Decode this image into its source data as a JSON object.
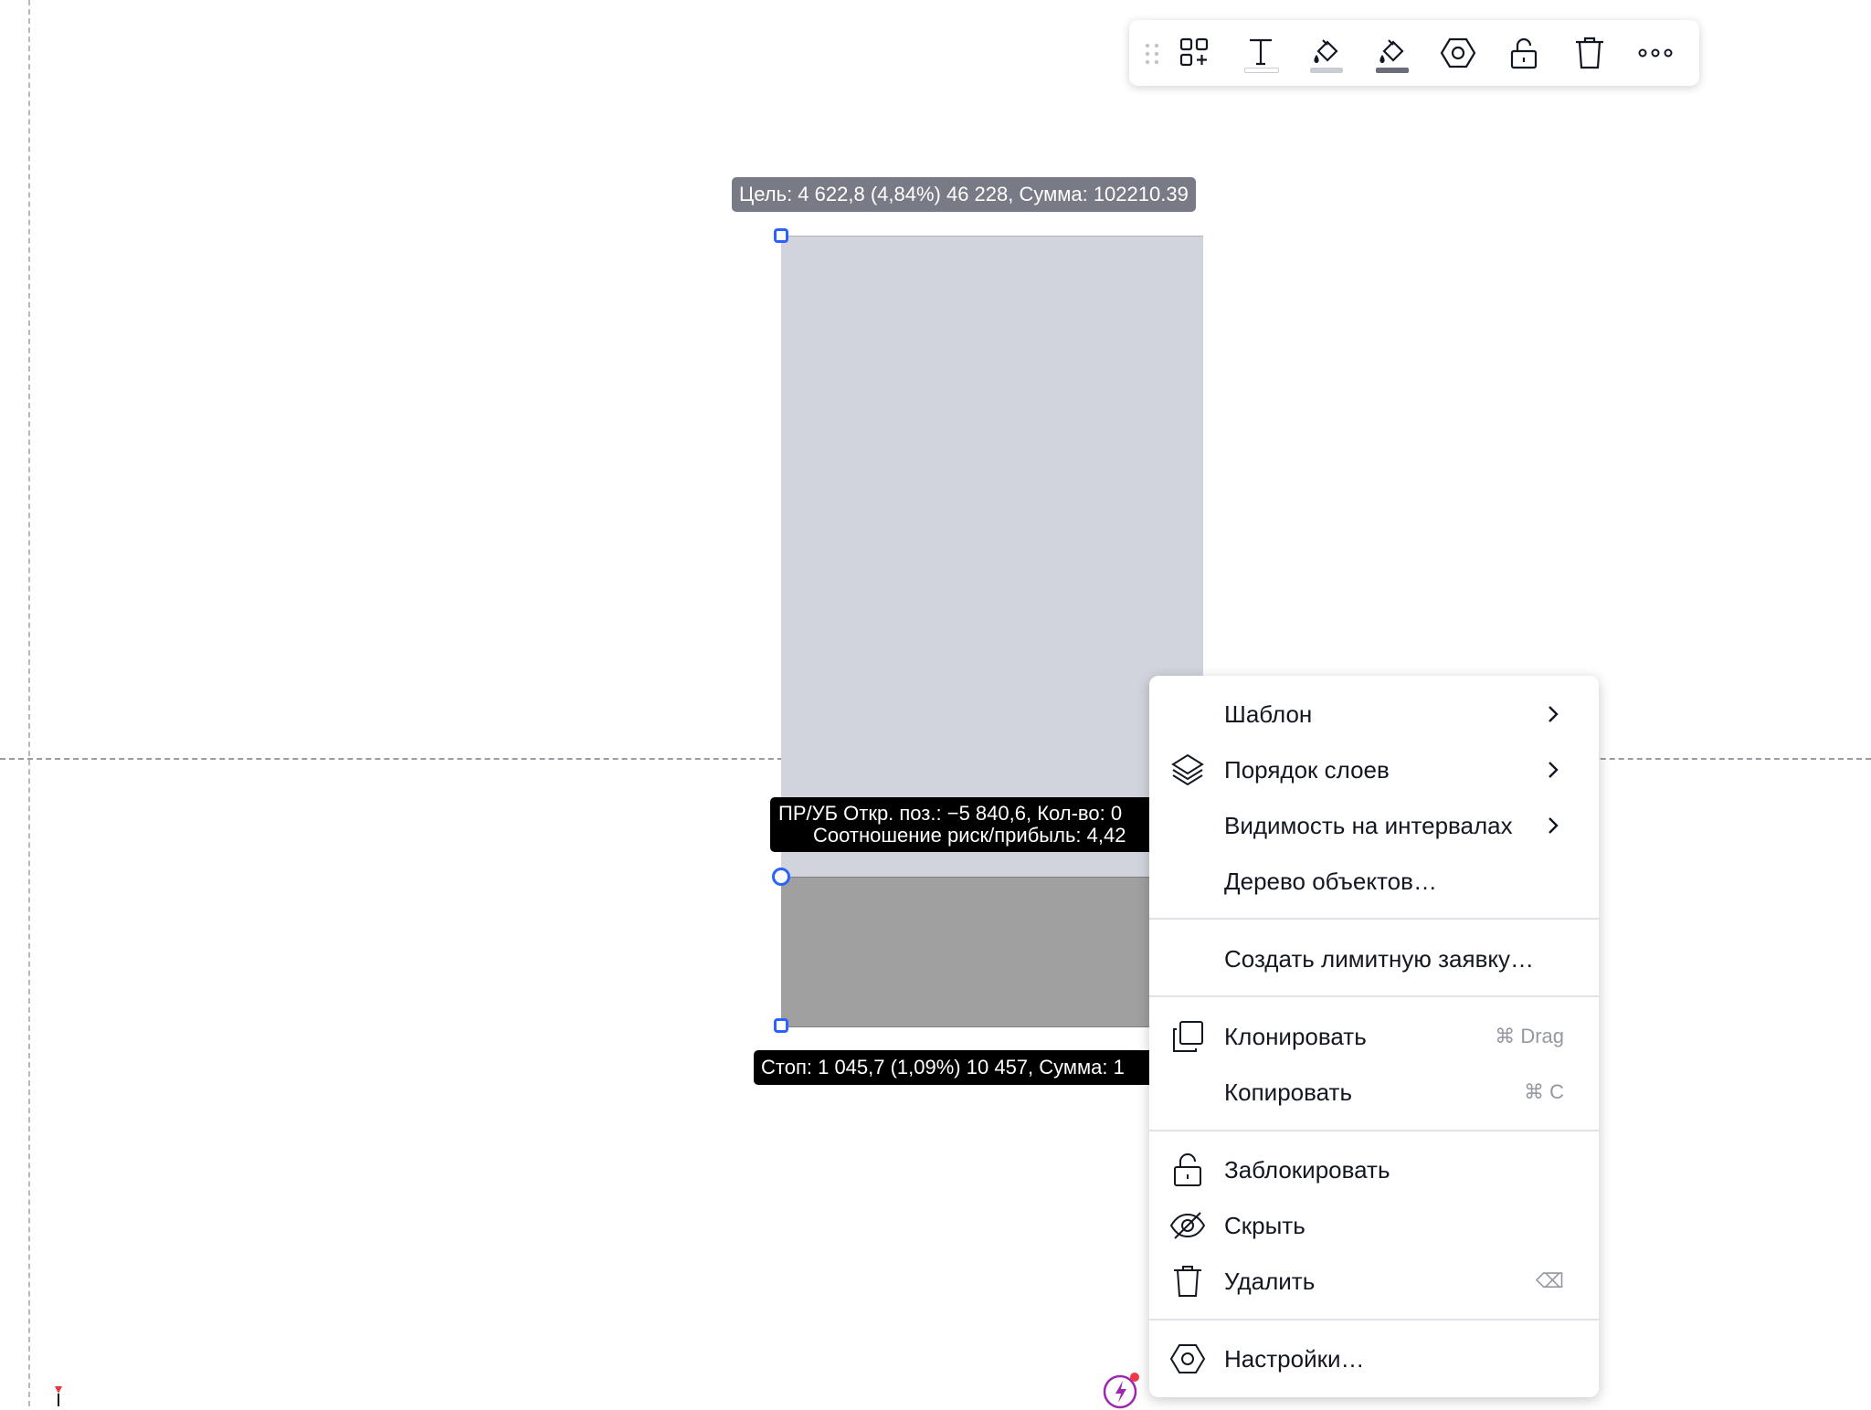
{
  "toolbar": {
    "buttons": [
      {
        "name": "drag-handle-icon"
      },
      {
        "name": "add-template-icon"
      },
      {
        "name": "text-icon"
      },
      {
        "name": "fill-bucket-light-icon"
      },
      {
        "name": "fill-bucket-dark-icon"
      },
      {
        "name": "settings-hexagon-icon"
      },
      {
        "name": "lock-open-icon"
      },
      {
        "name": "trash-icon"
      },
      {
        "name": "more-icon"
      }
    ]
  },
  "drawing": {
    "target_label": "Цель: 4 622,8 (4,84%) 46 228, Сумма: 102210.39",
    "pnl_line1": "ПР/УБ Откр. поз.: −5 840,6, Кол-во: 0",
    "pnl_line2": "Соотношение риск/прибыль: 4,42",
    "stop_label": "Стоп: 1 045,7 (1,09%) 10 457, Сумма: 1",
    "colors": {
      "target": "#d1d4dc",
      "stop": "#a0a0a0",
      "handle": "#2962ff"
    }
  },
  "context_menu": {
    "template": "Шаблон",
    "layer_order": "Порядок слоев",
    "visibility": "Видимость на интервалах",
    "object_tree": "Дерево объектов…",
    "create_limit_order": "Создать лимитную заявку…",
    "clone": "Клонировать",
    "clone_shortcut": "⌘ Drag",
    "copy": "Копировать",
    "copy_shortcut": "⌘ C",
    "lock": "Заблокировать",
    "hide": "Скрыть",
    "delete": "Удалить",
    "delete_shortcut": "⌫",
    "settings": "Настройки…"
  }
}
